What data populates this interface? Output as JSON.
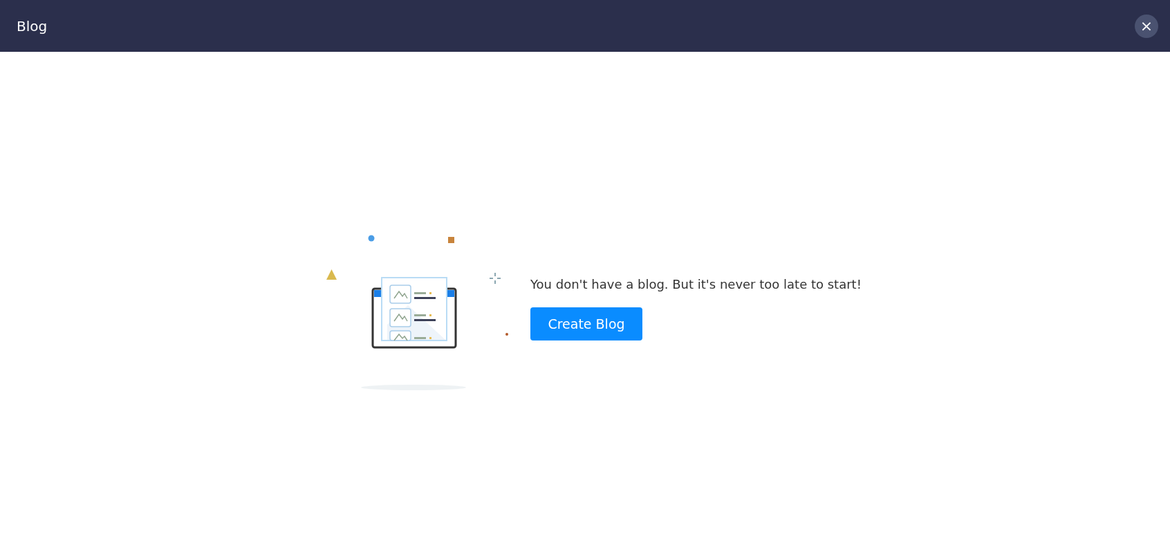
{
  "header": {
    "title": "Blog",
    "close_label": "×"
  },
  "empty_state": {
    "message": "You don't have a blog. But it's never too late to start!",
    "button": "Create Blog"
  }
}
